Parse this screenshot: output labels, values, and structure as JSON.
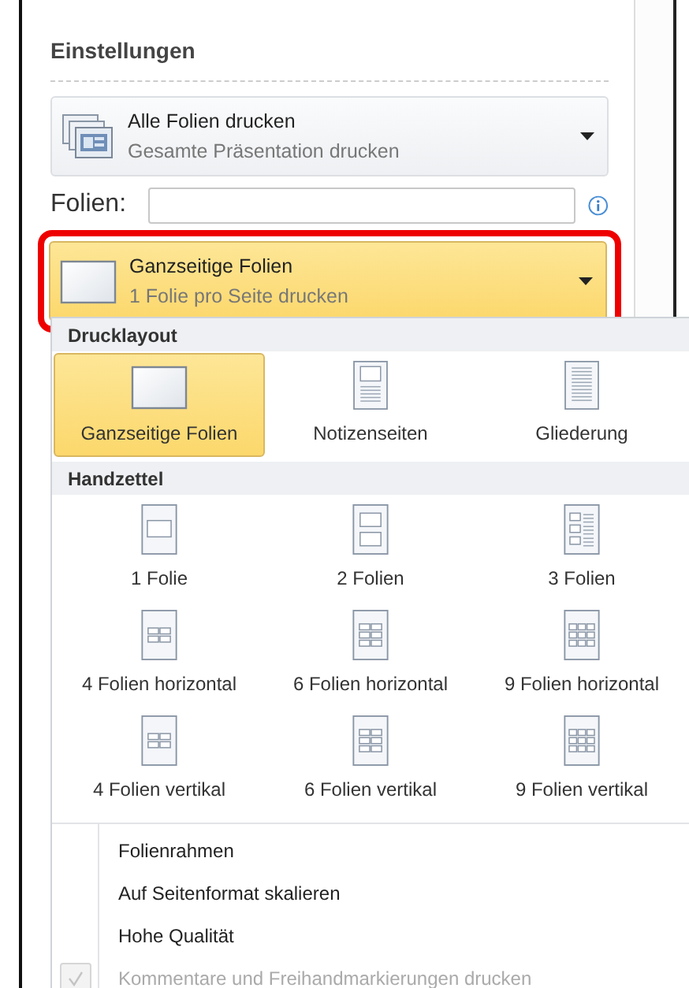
{
  "section_title": "Einstellungen",
  "range_dropdown": {
    "title": "Alle Folien drucken",
    "subtitle": "Gesamte Präsentation drucken"
  },
  "slides_field": {
    "label": "Folien:"
  },
  "layout_dropdown": {
    "title": "Ganzseitige Folien",
    "subtitle": "1 Folie pro Seite drucken",
    "highlighted": true
  },
  "menu": {
    "groups": [
      {
        "heading": "Drucklayout",
        "items": [
          {
            "label": "Ganzseitige Folien",
            "kind": "fullpage",
            "selected": true
          },
          {
            "label": "Notizenseiten",
            "kind": "notes",
            "selected": false
          },
          {
            "label": "Gliederung",
            "kind": "outline",
            "selected": false
          }
        ]
      },
      {
        "heading": "Handzettel",
        "items": [
          {
            "label": "1 Folie",
            "kind": "handout1",
            "selected": false
          },
          {
            "label": "2 Folien",
            "kind": "handout2",
            "selected": false
          },
          {
            "label": "3 Folien",
            "kind": "handout3",
            "selected": false
          },
          {
            "label": "4 Folien horizontal",
            "kind": "handout4h",
            "selected": false
          },
          {
            "label": "6 Folien horizontal",
            "kind": "handout6h",
            "selected": false
          },
          {
            "label": "9 Folien horizontal",
            "kind": "handout9h",
            "selected": false
          },
          {
            "label": "4 Folien vertikal",
            "kind": "handout4v",
            "selected": false
          },
          {
            "label": "6 Folien vertikal",
            "kind": "handout6v",
            "selected": false
          },
          {
            "label": "9 Folien vertikal",
            "kind": "handout9v",
            "selected": false
          }
        ]
      }
    ],
    "options": [
      {
        "label": "Folienrahmen",
        "checked": false,
        "disabled": false
      },
      {
        "label": "Auf Seitenformat skalieren",
        "checked": false,
        "disabled": false
      },
      {
        "label": "Hohe Qualität",
        "checked": false,
        "disabled": false
      },
      {
        "label": "Kommentare und Freihandmarkierungen drucken",
        "checked": true,
        "disabled": true
      }
    ]
  }
}
